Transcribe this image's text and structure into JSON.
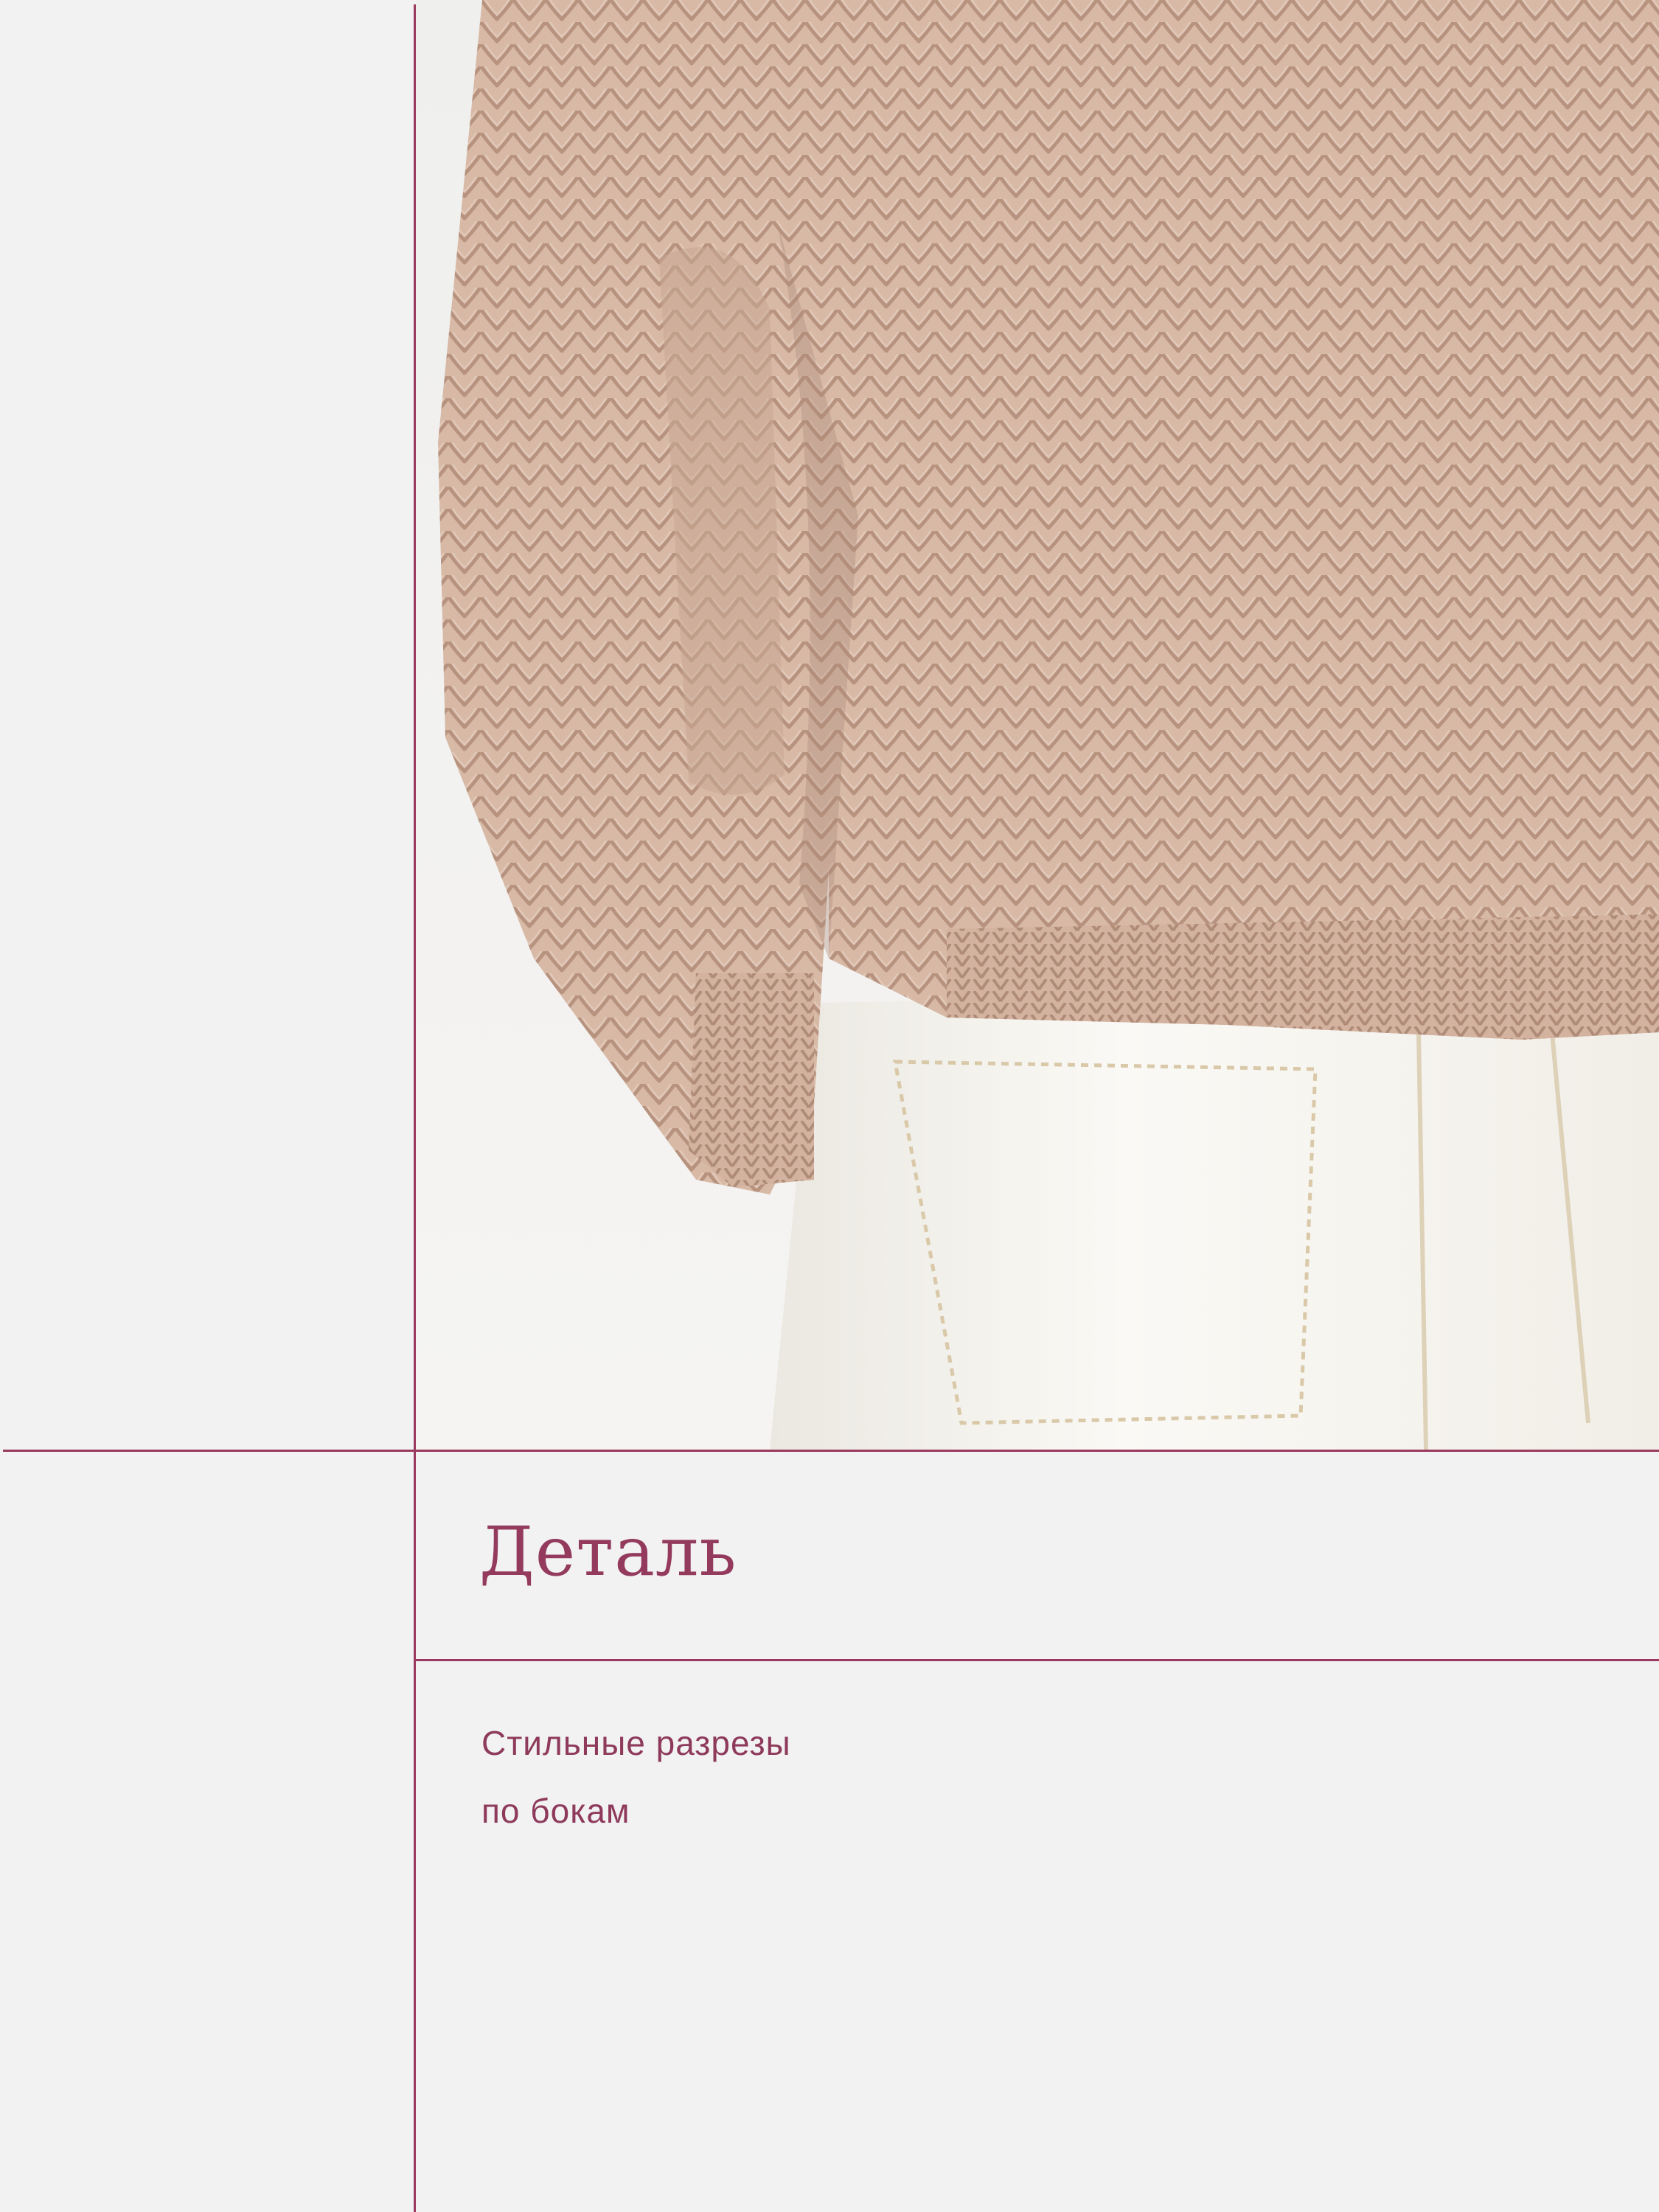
{
  "detail": {
    "title": "Деталь",
    "description_lines": [
      "Стильные разрезы",
      "по бокам"
    ]
  },
  "photo": {
    "subject": "knit-sweater-side-slit-photo"
  },
  "colors": {
    "background": "#f2f2f2",
    "accent": "#933a5d",
    "line": "#9a3a5e",
    "sweater": "#d6b8a5",
    "jeans": "#f4f2ec"
  }
}
